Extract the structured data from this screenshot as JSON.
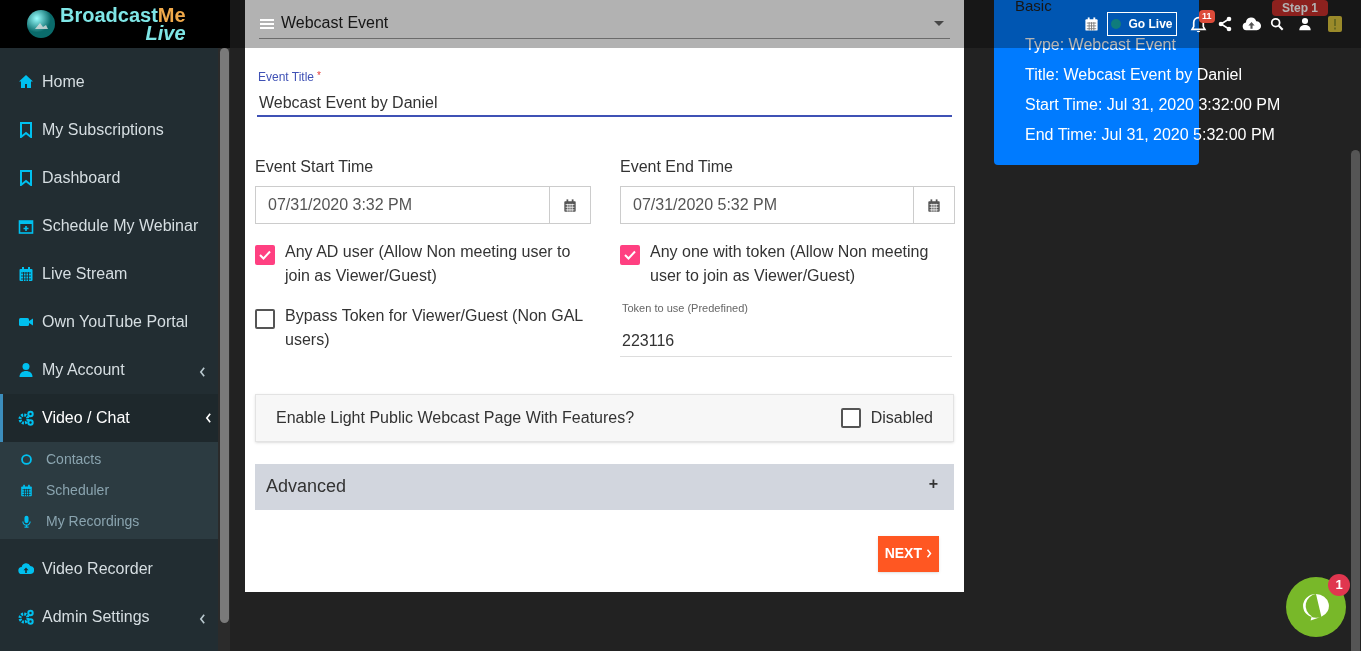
{
  "header": {
    "logo": {
      "word_a": "Broadcast",
      "word_b": "Me",
      "word_c": "Live"
    },
    "go_live": {
      "label": "Go Live",
      "online": true
    },
    "notifications": {
      "count": "11"
    }
  },
  "sidebar": {
    "items": [
      {
        "label": "Home",
        "selected": false
      },
      {
        "label": "My Subscriptions",
        "selected": false
      },
      {
        "label": "Dashboard",
        "selected": false
      },
      {
        "label": "Schedule My Webinar",
        "selected": false
      },
      {
        "label": "Live Stream",
        "selected": false
      },
      {
        "label": "Own YouTube Portal",
        "selected": false
      },
      {
        "label": "My Account",
        "selected": false,
        "expanded": false
      },
      {
        "label": "Video / Chat",
        "selected": true,
        "expanded": true,
        "children": [
          {
            "label": "Contacts"
          },
          {
            "label": "Scheduler"
          },
          {
            "label": "My Recordings"
          }
        ]
      },
      {
        "label": "Video Recorder",
        "selected": false
      },
      {
        "label": "Admin Settings",
        "selected": false,
        "expanded": false
      }
    ]
  },
  "form": {
    "event_type": {
      "value": "Webcast Event"
    },
    "event_title": {
      "label": "Event Title",
      "required_mark": "*",
      "value": "Webcast Event by Daniel"
    },
    "start_time": {
      "label": "Event Start Time",
      "value": "07/31/2020 3:32 PM"
    },
    "end_time": {
      "label": "Event End Time",
      "value": "07/31/2020 5:32 PM"
    },
    "left_options": [
      {
        "label": "Any AD user (Allow Non meeting user to join as Viewer/Guest)",
        "checked": true
      },
      {
        "label": "Bypass Token for Viewer/Guest (Non GAL users)",
        "checked": false
      }
    ],
    "right_options": [
      {
        "label": "Any one with token (Allow Non meeting user to join as Viewer/Guest)",
        "checked": true
      }
    ],
    "token": {
      "label": "Token to use (Predefined)",
      "value": "223116"
    },
    "public_page": {
      "label": "Enable Light Public Webcast Page With Features?",
      "checked": false,
      "status": "Disabled"
    },
    "advanced": {
      "label": "Advanced",
      "expanded": false,
      "toggle": "+"
    },
    "next_button": "NEXT"
  },
  "summary": {
    "section": "Basic",
    "step": "Step 1",
    "lines": [
      "Type: Webcast Event",
      "Title: Webcast Event by Daniel",
      "Start Time: Jul 31, 2020 3:32:00 PM",
      "End Time: Jul 31, 2020 5:32:00 PM"
    ]
  },
  "chat": {
    "unread": "1"
  }
}
